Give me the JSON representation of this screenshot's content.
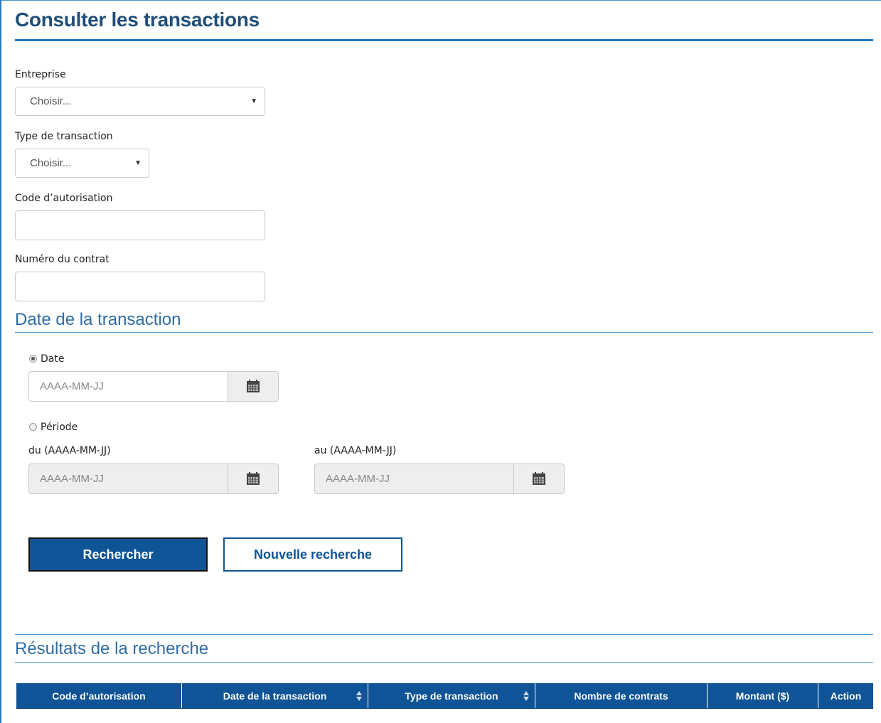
{
  "page": {
    "title": "Consulter les transactions"
  },
  "form": {
    "entreprise": {
      "label": "Entreprise",
      "value": "Choisir..."
    },
    "type_transaction": {
      "label": "Type de transaction",
      "value": "Choisir..."
    },
    "code_autorisation": {
      "label": "Code d’autorisation",
      "value": ""
    },
    "numero_contrat": {
      "label": "Numéro du contrat",
      "value": ""
    }
  },
  "date_section": {
    "title": "Date de la transaction",
    "date_option": {
      "label": "Date",
      "checked": true,
      "placeholder": "AAAA-MM-JJ"
    },
    "periode_option": {
      "label": "Période",
      "checked": false
    },
    "from": {
      "label": "du (AAAA-MM-JJ)",
      "placeholder": "AAAA-MM-JJ"
    },
    "to": {
      "label": "au (AAAA-MM-JJ)",
      "placeholder": "AAAA-MM-JJ"
    }
  },
  "buttons": {
    "search": "Rechercher",
    "new_search": "Nouvelle recherche"
  },
  "results": {
    "title": "Résultats de la recherche",
    "columns": [
      {
        "label": "Code d’autorisation",
        "sortable": false
      },
      {
        "label": "Date de la transaction",
        "sortable": true
      },
      {
        "label": "Type de transaction",
        "sortable": true
      },
      {
        "label": "Nombre de contrats",
        "sortable": false
      },
      {
        "label": "Montant ($)",
        "sortable": false
      },
      {
        "label": "Action",
        "sortable": false
      }
    ]
  },
  "icons": {
    "calendar": "calendar-icon",
    "sort": "sort-icon",
    "dropdown": "caret-down-icon"
  },
  "colors": {
    "primary": "#0f5496",
    "accent": "#1f7ac2",
    "title": "#1f4e79"
  }
}
